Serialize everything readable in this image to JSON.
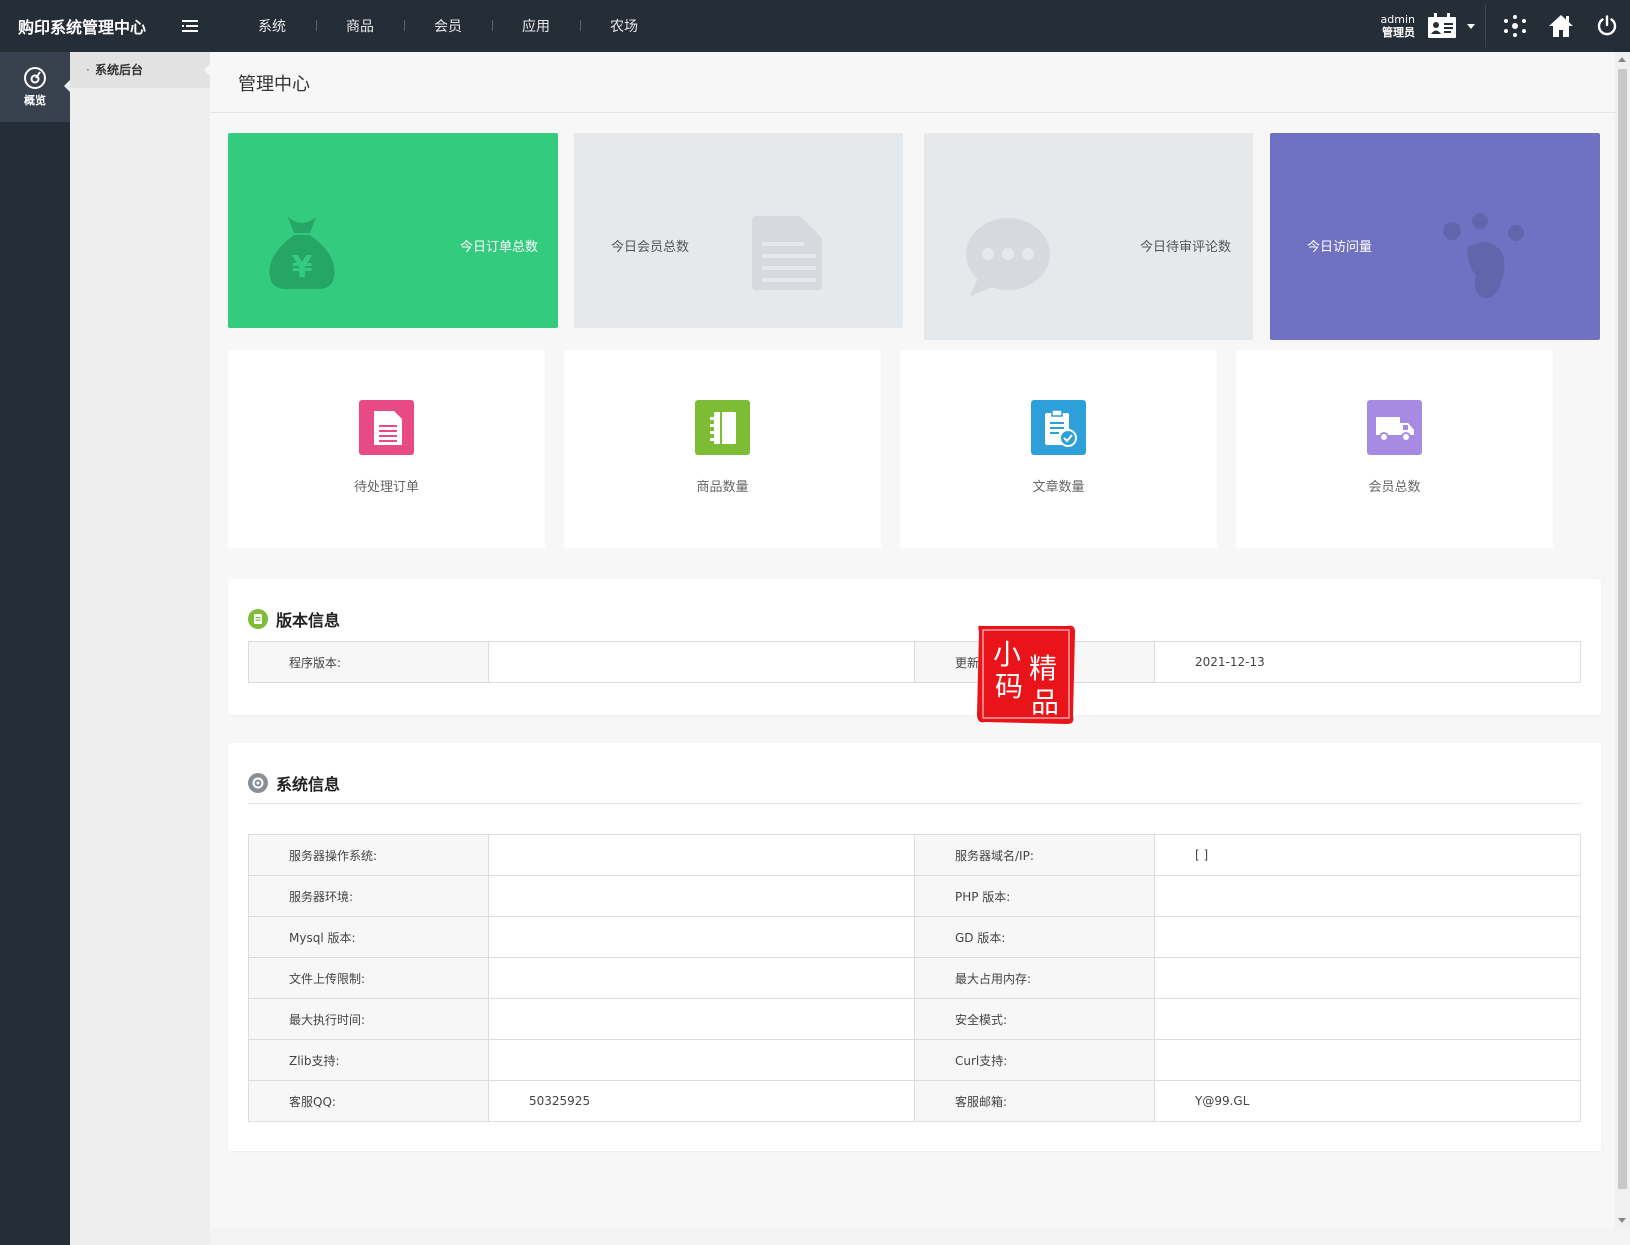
{
  "header": {
    "brand": "购印系统管理中心",
    "nav": [
      "系统",
      "商品",
      "会员",
      "应用",
      "农场"
    ],
    "user_name": "admin",
    "user_role": "管理员",
    "icons": [
      "menu-toggle-icon",
      "user-card-icon",
      "caret-down-icon",
      "network-icon",
      "home-icon",
      "power-icon"
    ]
  },
  "rail": {
    "items": [
      {
        "label": "概览",
        "icon": "dashboard-icon"
      }
    ]
  },
  "submenu": {
    "items": [
      "系统后台"
    ]
  },
  "main": {
    "title": "管理中心",
    "stats": [
      {
        "label": "今日订单总数",
        "color": "#33cc7f",
        "icon": "money-bag-icon"
      },
      {
        "label": "今日会员总数",
        "color": "#e6e9ec",
        "icon": "document-icon"
      },
      {
        "label": "今日待审评论数",
        "color": "#e6e9ec",
        "icon": "chat-bubble-icon"
      },
      {
        "label": "今日访问量",
        "color": "#6f72c2",
        "icon": "paw-icon"
      }
    ],
    "shortcuts": [
      {
        "label": "待处理订单",
        "color": "#e84a85",
        "icon": "order-doc-icon"
      },
      {
        "label": "商品数量",
        "color": "#7cbd35",
        "icon": "notebook-icon"
      },
      {
        "label": "文章数量",
        "color": "#2d9fd9",
        "icon": "clipboard-check-icon"
      },
      {
        "label": "会员总数",
        "color": "#a78be3",
        "icon": "truck-icon"
      }
    ]
  },
  "version_panel": {
    "title": "版本信息",
    "rows": [
      {
        "k1": "程序版本:",
        "v1": "",
        "k2": "更新时间:",
        "v2": "2021-12-13"
      }
    ]
  },
  "system_panel": {
    "title": "系统信息",
    "rows": [
      {
        "k1": "服务器操作系统:",
        "v1": "",
        "k2": "服务器域名/IP:",
        "v2": "[ ]"
      },
      {
        "k1": "服务器环境:",
        "v1": "",
        "k2": "PHP 版本:",
        "v2": ""
      },
      {
        "k1": "Mysql 版本:",
        "v1": "",
        "k2": "GD 版本:",
        "v2": ""
      },
      {
        "k1": "文件上传限制:",
        "v1": "",
        "k2": "最大占用内存:",
        "v2": ""
      },
      {
        "k1": "最大执行时间:",
        "v1": "",
        "k2": "安全模式:",
        "v2": ""
      },
      {
        "k1": "Zlib支持:",
        "v1": "",
        "k2": "Curl支持:",
        "v2": ""
      },
      {
        "k1": "客服QQ:",
        "v1": "50325925",
        "k2": "客服邮箱:",
        "v2": "Y@99.GL"
      }
    ]
  },
  "watermark": {
    "text": "小码精品",
    "color": "#e8141a"
  }
}
